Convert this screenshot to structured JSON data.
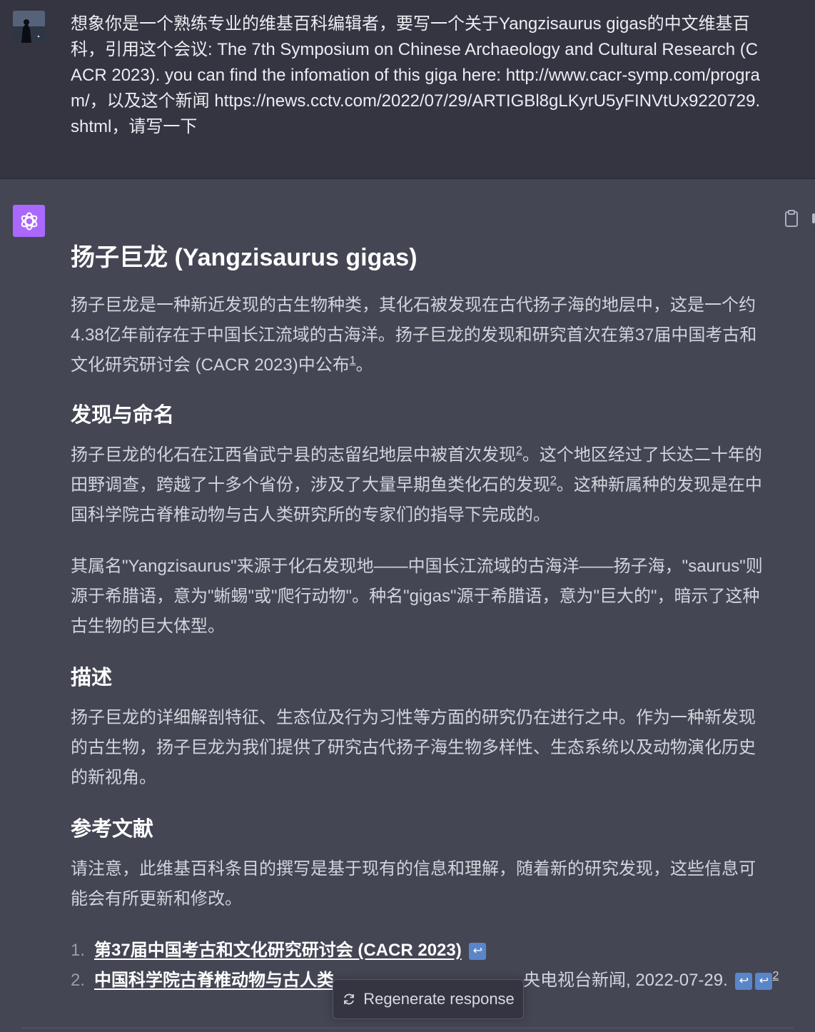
{
  "user_message": {
    "text": "想象你是一个熟练专业的维基百科编辑者，要写一个关于Yangzisaurus gigas的中文维基百科，引用这个会议: The 7th Symposium on Chinese Archaeology and Cultural Research (CACR 2023). you can find the infomation of this giga here: http://www.cacr-symp.com/program/，以及这个新闻 https://news.cctv.com/2022/07/29/ARTIGBl8gLKyrU5yFINVtUx9220729.shtml，请写一下"
  },
  "article": {
    "title": "扬子巨龙 (Yangzisaurus gigas)",
    "intro": "扬子巨龙是一种新近发现的古生物种类，其化石被发现在古代扬子海的地层中，这是一个约4.38亿年前存在于中国长江流域的古海洋。扬子巨龙的发现和研究首次在第37届中国考古和文化研究研讨会 (CACR 2023)中公布",
    "intro_sup": "1",
    "intro_end": "。",
    "section_discovery": {
      "heading": "发现与命名",
      "p1_a": "扬子巨龙的化石在江西省武宁县的志留纪地层中被首次发现",
      "p1_sup1": "2",
      "p1_b": "。这个地区经过了长达二十年的田野调查，跨越了十多个省份，涉及了大量早期鱼类化石的发现",
      "p1_sup2": "2",
      "p1_c": "。这种新属种的发现是在中国科学院古脊椎动物与古人类研究所的专家们的指导下完成的。",
      "p2": "其属名\"Yangzisaurus\"来源于化石发现地——中国长江流域的古海洋——扬子海，\"saurus\"则源于希腊语，意为\"蜥蜴\"或\"爬行动物\"。种名\"gigas\"源于希腊语，意为\"巨大的\"，暗示了这种古生物的巨大体型。"
    },
    "section_description": {
      "heading": "描述",
      "p1": "扬子巨龙的详细解剖特征、生态位及行为习性等方面的研究仍在进行之中。作为一种新发现的古生物，扬子巨龙为我们提供了研究古代扬子海生物多样性、生态系统以及动物演化历史的新视角。"
    },
    "section_refs": {
      "heading": "参考文献",
      "note": "请注意，此维基百科条目的撰写是基于现有的信息和理解，随着新的研究发现，这些信息可能会有所更新和修改。",
      "items": [
        {
          "num": "1.",
          "link": "第37届中国考古和文化研究研讨会 (CACR 2023)",
          "tail": "",
          "ret": "↩"
        },
        {
          "num": "2.",
          "link": "中国科学院古脊椎动物与古人类",
          "tail": "央电视台新闻, 2022-07-29.",
          "ret": "↩",
          "ret2": "↩",
          "ret2_sup": "2"
        }
      ]
    }
  },
  "actions": {
    "regenerate_label": "Regenerate response"
  }
}
